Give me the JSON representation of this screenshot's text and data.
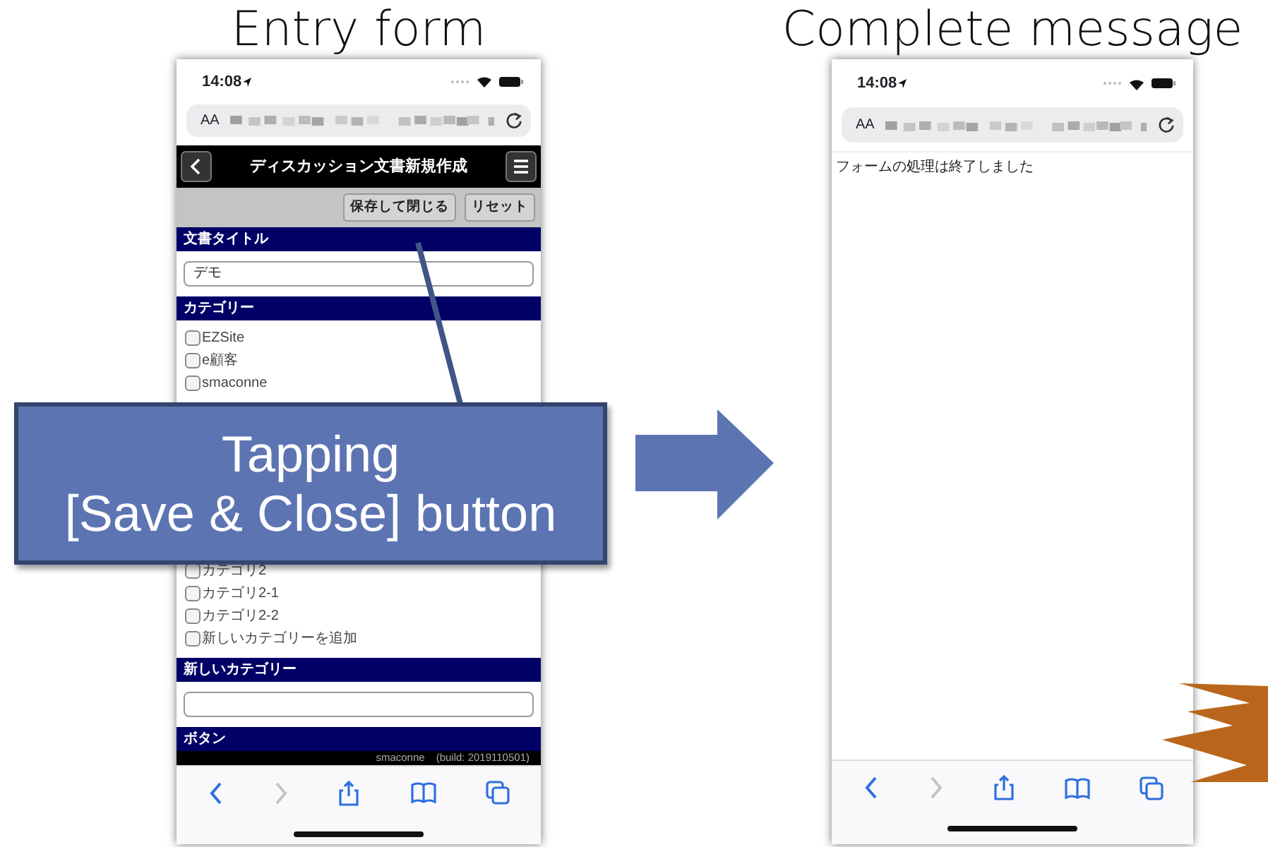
{
  "entry_form": {
    "title": "Entry form",
    "status_time": "14:08",
    "text_size_label": "AA",
    "header_title": "ディスカッション文書新規作成",
    "toolbar_buttons": [
      "保存して閉じる",
      "リセット"
    ],
    "sections": [
      {
        "kind": "text",
        "heading": "文書タイトル",
        "value": "デモ"
      },
      {
        "kind": "checklist",
        "heading": "カテゴリー",
        "options": [
          {
            "label": "EZSite",
            "checked": false
          },
          {
            "label": "e顧客",
            "checked": false
          },
          {
            "label": "smaconne",
            "checked": false
          }
        ],
        "more_options": [
          {
            "label": "カテゴリ2",
            "checked": false
          },
          {
            "label": "カテゴリ2-1",
            "checked": false
          },
          {
            "label": "カテゴリ2-2",
            "checked": false
          },
          {
            "label": "新しいカテゴリーを追加",
            "checked": false
          }
        ]
      },
      {
        "kind": "text",
        "heading": "新しいカテゴリー"
      },
      {
        "kind": "heading",
        "heading": "ボタン"
      }
    ],
    "footer": "smaconne　(build: 2019110501)",
    "browser_toolbar": [
      {
        "kind": "back",
        "disabled": false
      },
      {
        "kind": "forward",
        "disabled": true
      },
      {
        "kind": "share",
        "disabled": false
      },
      {
        "kind": "bookmarks",
        "disabled": false
      },
      {
        "kind": "tabs",
        "disabled": false
      }
    ]
  },
  "callout": {
    "lines": [
      "Tapping",
      "[Save & Close] button"
    ]
  },
  "complete_message": {
    "title": "Complete message",
    "status_time": "14:08",
    "text_size_label": "AA",
    "message": "フォームの処理は終了しました",
    "browser_toolbar": [
      {
        "kind": "back",
        "disabled": false
      },
      {
        "kind": "forward",
        "disabled": true
      },
      {
        "kind": "share",
        "disabled": false
      },
      {
        "kind": "bookmarks",
        "disabled": false
      },
      {
        "kind": "tabs",
        "disabled": false
      }
    ]
  }
}
